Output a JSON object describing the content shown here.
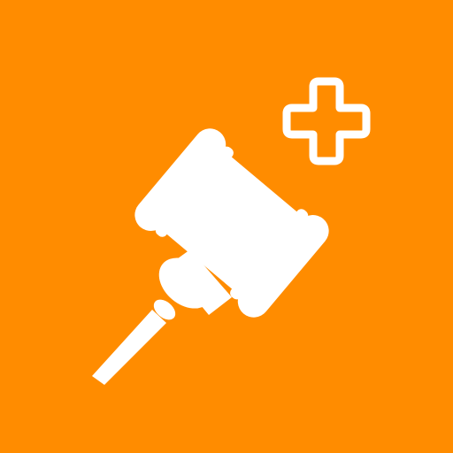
{
  "app_icon": {
    "background_color": "#ff8c00",
    "glyph_color": "#ffffff",
    "main_icon": "gavel-icon",
    "badge_icon": "plus-icon"
  }
}
